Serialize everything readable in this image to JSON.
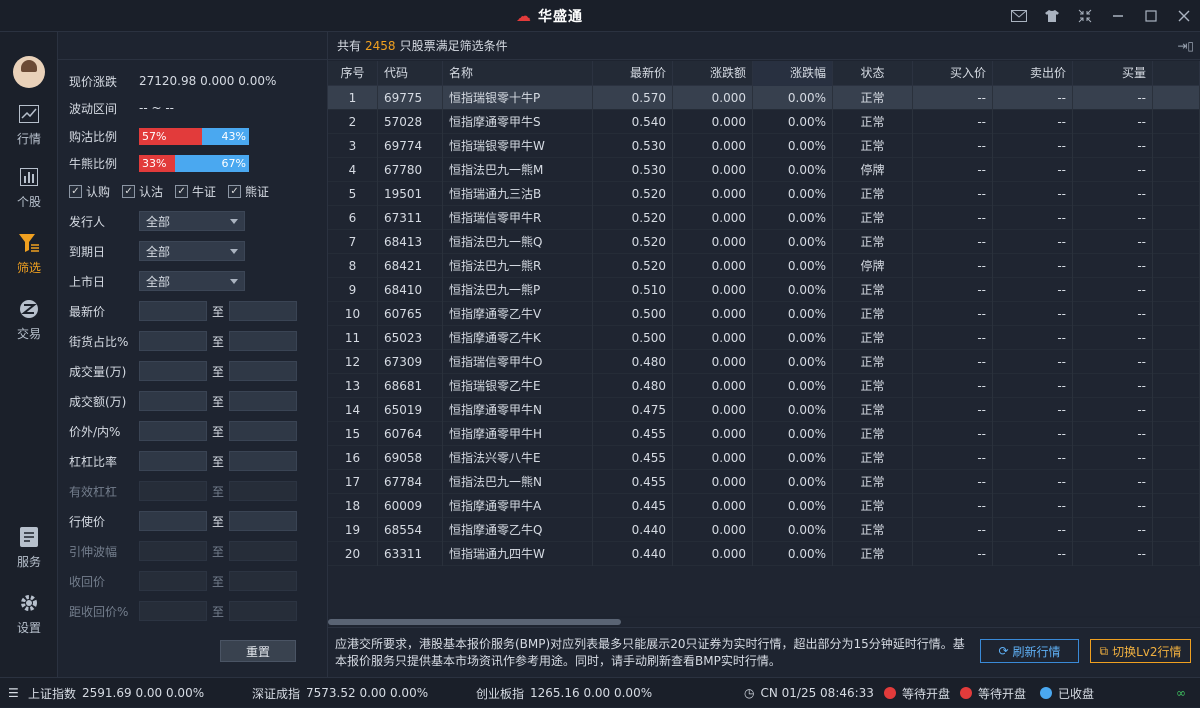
{
  "app": {
    "title": "华盛通",
    "logo_glyph": "☁"
  },
  "titlebar_icons": [
    "mail-icon",
    "shirt-icon",
    "collapse-icon",
    "minimize-icon",
    "maximize-icon",
    "close-icon"
  ],
  "nav": {
    "items": [
      {
        "label": "行情",
        "icon": "chart-line-icon"
      },
      {
        "label": "个股",
        "icon": "bar-chart-icon"
      },
      {
        "label": "筛选",
        "icon": "filter-icon",
        "active": true
      },
      {
        "label": "交易",
        "icon": "trade-icon"
      },
      {
        "label": "服务",
        "icon": "document-icon"
      },
      {
        "label": "设置",
        "icon": "gear-icon"
      }
    ]
  },
  "filters": {
    "price_change_label": "现价涨跌",
    "price_change_value": "27120.98  0.000  0.00%",
    "range_label": "波动区间",
    "range_value": "--  ~  --",
    "call_put_label": "购沽比例",
    "call_pct": "57%",
    "call_ratio": 0.57,
    "put_pct": "43%",
    "bull_bear_label": "牛熊比例",
    "bull_pct": "33%",
    "bull_ratio": 0.33,
    "bear_pct": "67%",
    "checkboxes": [
      "认购",
      "认沽",
      "牛证",
      "熊证"
    ],
    "issuer_label": "发行人",
    "issuer_value": "全部",
    "expiry_label": "到期日",
    "expiry_value": "全部",
    "listing_label": "上市日",
    "listing_value": "全部",
    "to": "至",
    "ranges": [
      {
        "label": "最新价",
        "enabled": true
      },
      {
        "label": "街货占比%",
        "enabled": true
      },
      {
        "label": "成交量(万)",
        "enabled": true
      },
      {
        "label": "成交额(万)",
        "enabled": true
      },
      {
        "label": "价外/内%",
        "enabled": true
      },
      {
        "label": "杠杠比率",
        "enabled": true
      },
      {
        "label": "有效杠杠",
        "enabled": false
      },
      {
        "label": "行使价",
        "enabled": true
      },
      {
        "label": "引伸波幅",
        "enabled": false
      },
      {
        "label": "收回价",
        "enabled": false
      },
      {
        "label": "距收回价%",
        "enabled": false
      }
    ],
    "reset_label": "重置"
  },
  "summary": {
    "prefix": "共有",
    "count": "2458",
    "suffix": "只股票满足筛选条件"
  },
  "table": {
    "columns": [
      "序号",
      "代码",
      "名称",
      "最新价",
      "涨跌额",
      "涨跌幅",
      "状态",
      "买入价",
      "卖出价",
      "买量"
    ],
    "rows": [
      [
        "1",
        "69775",
        "恒指瑞银零十牛P",
        "0.570",
        "0.000",
        "0.00%",
        "正常",
        "--",
        "--",
        "--"
      ],
      [
        "2",
        "57028",
        "恒指摩通零甲牛S",
        "0.540",
        "0.000",
        "0.00%",
        "正常",
        "--",
        "--",
        "--"
      ],
      [
        "3",
        "69774",
        "恒指瑞银零甲牛W",
        "0.530",
        "0.000",
        "0.00%",
        "正常",
        "--",
        "--",
        "--"
      ],
      [
        "4",
        "67780",
        "恒指法巴九一熊M",
        "0.530",
        "0.000",
        "0.00%",
        "停牌",
        "--",
        "--",
        "--"
      ],
      [
        "5",
        "19501",
        "恒指瑞通九三沽B",
        "0.520",
        "0.000",
        "0.00%",
        "正常",
        "--",
        "--",
        "--"
      ],
      [
        "6",
        "67311",
        "恒指瑞信零甲牛R",
        "0.520",
        "0.000",
        "0.00%",
        "正常",
        "--",
        "--",
        "--"
      ],
      [
        "7",
        "68413",
        "恒指法巴九一熊Q",
        "0.520",
        "0.000",
        "0.00%",
        "正常",
        "--",
        "--",
        "--"
      ],
      [
        "8",
        "68421",
        "恒指法巴九一熊R",
        "0.520",
        "0.000",
        "0.00%",
        "停牌",
        "--",
        "--",
        "--"
      ],
      [
        "9",
        "68410",
        "恒指法巴九一熊P",
        "0.510",
        "0.000",
        "0.00%",
        "正常",
        "--",
        "--",
        "--"
      ],
      [
        "10",
        "60765",
        "恒指摩通零乙牛V",
        "0.500",
        "0.000",
        "0.00%",
        "正常",
        "--",
        "--",
        "--"
      ],
      [
        "11",
        "65023",
        "恒指摩通零乙牛K",
        "0.500",
        "0.000",
        "0.00%",
        "正常",
        "--",
        "--",
        "--"
      ],
      [
        "12",
        "67309",
        "恒指瑞信零甲牛O",
        "0.480",
        "0.000",
        "0.00%",
        "正常",
        "--",
        "--",
        "--"
      ],
      [
        "13",
        "68681",
        "恒指瑞银零乙牛E",
        "0.480",
        "0.000",
        "0.00%",
        "正常",
        "--",
        "--",
        "--"
      ],
      [
        "14",
        "65019",
        "恒指摩通零甲牛N",
        "0.475",
        "0.000",
        "0.00%",
        "正常",
        "--",
        "--",
        "--"
      ],
      [
        "15",
        "60764",
        "恒指摩通零甲牛H",
        "0.455",
        "0.000",
        "0.00%",
        "正常",
        "--",
        "--",
        "--"
      ],
      [
        "16",
        "69058",
        "恒指法兴零八牛E",
        "0.455",
        "0.000",
        "0.00%",
        "正常",
        "--",
        "--",
        "--"
      ],
      [
        "17",
        "67784",
        "恒指法巴九一熊N",
        "0.455",
        "0.000",
        "0.00%",
        "正常",
        "--",
        "--",
        "--"
      ],
      [
        "18",
        "60009",
        "恒指摩通零甲牛A",
        "0.445",
        "0.000",
        "0.00%",
        "正常",
        "--",
        "--",
        "--"
      ],
      [
        "19",
        "68554",
        "恒指摩通零乙牛Q",
        "0.440",
        "0.000",
        "0.00%",
        "正常",
        "--",
        "--",
        "--"
      ],
      [
        "20",
        "63311",
        "恒指瑞通九四牛W",
        "0.440",
        "0.000",
        "0.00%",
        "正常",
        "--",
        "--",
        "--"
      ]
    ]
  },
  "notice": {
    "text": "应港交所要求，港股基本报价服务(BMP)对应列表最多只能展示20只证券为实时行情，超出部分为15分钟延时行情。基本报价服务只提供基本市场资讯作参考用途。同时，请手动刷新查看BMP实时行情。",
    "refresh_label": "刷新行情",
    "lv2_label": "切换Lv2行情"
  },
  "status": {
    "sh_label": "上证指数",
    "sh_value": "2591.69  0.00  0.00%",
    "sz_label": "深证成指",
    "sz_value": "7573.52  0.00  0.00%",
    "cy_label": "创业板指",
    "cy_value": "1265.16  0.00  0.00%",
    "time": "CN 01/25 08:46:33",
    "hk_status": "等待开盘",
    "cn_status": "等待开盘",
    "closed": "已收盘"
  },
  "colors": {
    "accent": "#f0a020",
    "red": "#e23b3b",
    "blue": "#4aa8f0",
    "link": "#5fb0f5"
  }
}
